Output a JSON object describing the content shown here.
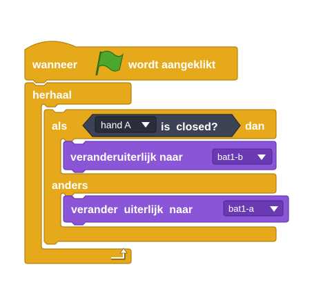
{
  "hat_block": {
    "label_before": "wanneer",
    "icon": "green-flag-icon",
    "label_after": "wordt aangeklikt"
  },
  "forever_block": {
    "label": "herhaal",
    "loop_icon": "loop-arrow-icon"
  },
  "if_else_block": {
    "if_label": "als",
    "then_label": "dan",
    "else_label": "anders"
  },
  "condition": {
    "sensor_value": "hand A",
    "sensor_label": "is  closed?"
  },
  "then_action": {
    "label": "veranderuiterlijk naar",
    "costume": "bat1-b"
  },
  "else_action": {
    "label": "verander  uiterlijk  naar",
    "costume": "bat1-a"
  },
  "colors": {
    "control": "#E6A91C",
    "control_edge": "#B5820E",
    "looks": "#8A55D7",
    "looks_edge": "#6A3AB2",
    "sensing": "#3D4355",
    "sensing_edge": "#23272F",
    "flag": "#4FA62E"
  }
}
